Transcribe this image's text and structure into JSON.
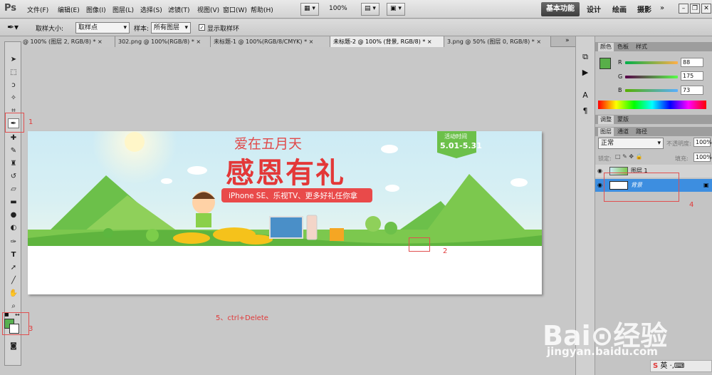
{
  "app": {
    "logo": "Ps"
  },
  "menu": [
    "文件(F)",
    "编辑(E)",
    "图像(I)",
    "图层(L)",
    "选择(S)",
    "滤镜(T)",
    "视图(V)",
    "窗口(W)",
    "帮助(H)"
  ],
  "menubar": {
    "zoom": "100%"
  },
  "workspaces": {
    "basic": "基本功能",
    "design": "设计",
    "paint": "绘画",
    "photo": "摄影"
  },
  "options": {
    "sample_size_label": "取样大小:",
    "sample_size_value": "取样点",
    "sample_label": "样本:",
    "sample_value": "所有图层",
    "show_ring_label": "显示取样环",
    "show_ring_checked": true
  },
  "tabs": [
    {
      "label": "@ 100% (图层 2, RGB/8) *",
      "active": false
    },
    {
      "label": "302.png @ 100%(RGB/8) *",
      "active": false
    },
    {
      "label": "未标题-1 @ 100%(RGB/8/CMYK) *",
      "active": false
    },
    {
      "label": "未标题-2 @ 100% (背景, RGB/8) *",
      "active": true
    },
    {
      "label": "3.png @ 50% (图层 0, RGB/8) *",
      "active": false
    }
  ],
  "banner": {
    "title_top": "爱在五月天",
    "title_main": "感恩有礼",
    "ribbon": "iPhone SE、乐视TV、更多好礼任你拿",
    "badge_label": "活动时间",
    "badge_dates": "5.01-5.31"
  },
  "annotations": {
    "n1": "1",
    "n2": "2",
    "n3": "3",
    "n4": "4",
    "n5": "5、ctrl+Delete"
  },
  "color_panel": {
    "tabs": [
      "颜色",
      "色板",
      "样式"
    ],
    "r_label": "R",
    "g_label": "G",
    "b_label": "B",
    "r": "88",
    "g": "175",
    "b": "73",
    "fg_color": "#58af49"
  },
  "adjust_tabs": [
    "调整",
    "蒙版"
  ],
  "layers_panel": {
    "tabs": [
      "图层",
      "通道",
      "路径"
    ],
    "blend_mode": "正常",
    "opacity_label": "不透明度:",
    "opacity": "100%",
    "lock_label": "锁定:",
    "fill_label": "填充:",
    "fill": "100%",
    "layers": [
      {
        "name": "图层 1",
        "selected": false
      },
      {
        "name": "背景",
        "selected": true
      }
    ]
  },
  "watermark": {
    "brand": "Bai⊙经验",
    "url": "jingyan.baidu.com"
  },
  "taskbar": {
    "ime": "英"
  }
}
